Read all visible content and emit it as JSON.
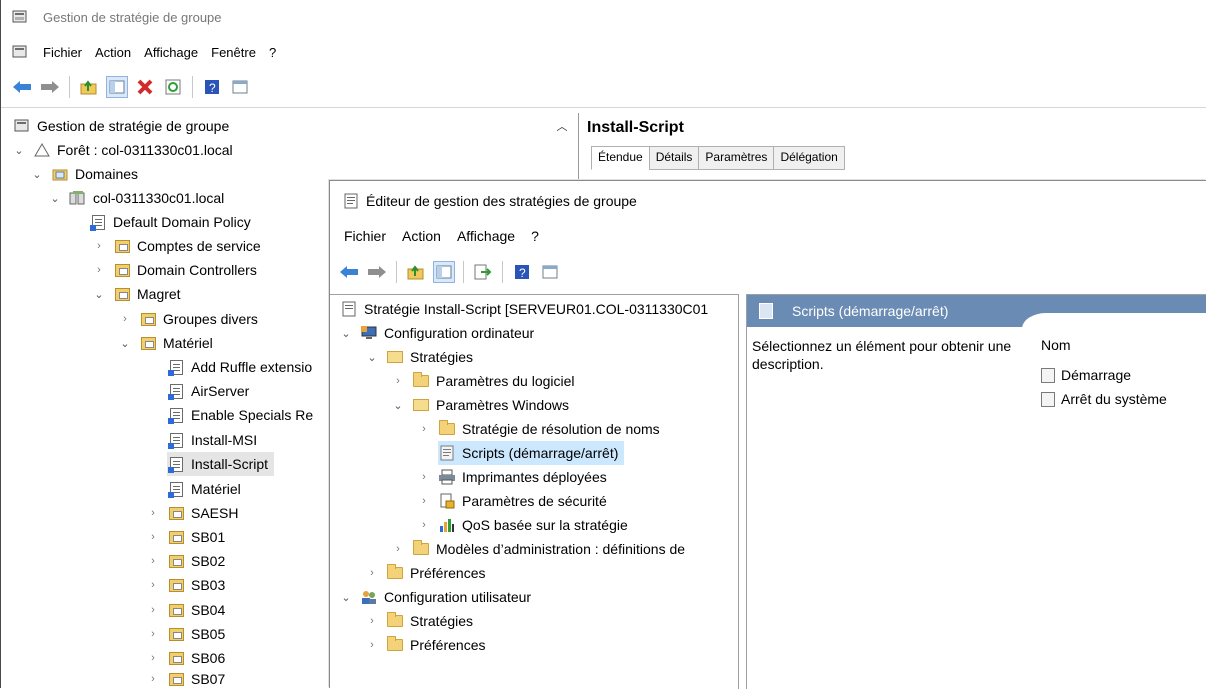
{
  "app": {
    "title": "Gestion de stratégie de groupe",
    "menu": [
      "Fichier",
      "Action",
      "Affichage",
      "Fenêtre",
      "?"
    ]
  },
  "tree": {
    "root": "Gestion de stratégie de groupe",
    "forest": "Forêt : col-0311330c01.local",
    "domains": "Domaines",
    "domain": "col-0311330c01.local",
    "items": {
      "ddp": "Default Domain Policy",
      "comptes": "Comptes de service",
      "dc": "Domain Controllers",
      "magret": "Magret",
      "groupes": "Groupes divers",
      "materiel": "Matériel",
      "addruffle": "Add Ruffle extensio",
      "airserver": "AirServer",
      "enablespecials": "Enable Specials Re",
      "installmsi": "Install-MSI",
      "installscript": "Install-Script",
      "materielgpo": "Matériel",
      "saesh": "SAESH",
      "sb01": "SB01",
      "sb02": "SB02",
      "sb03": "SB03",
      "sb04": "SB04",
      "sb05": "SB05",
      "sb06": "SB06",
      "sb07": "SB07"
    }
  },
  "gpo_panel": {
    "title": "Install-Script",
    "tabs": [
      "Étendue",
      "Détails",
      "Paramètres",
      "Délégation"
    ]
  },
  "editor": {
    "title": "Éditeur de gestion des stratégies de groupe",
    "menu": [
      "Fichier",
      "Action",
      "Affichage",
      "?"
    ],
    "tree": {
      "root": "Stratégie Install-Script [SERVEUR01.COL-0311330C01",
      "comp_config": "Configuration ordinateur",
      "strategies": "Stratégies",
      "param_logiciel": "Paramètres du logiciel",
      "param_windows": "Paramètres Windows",
      "resolution_noms": "Stratégie de résolution de noms",
      "scripts": "Scripts (démarrage/arrêt)",
      "imprimantes": "Imprimantes déployées",
      "securite": "Paramètres de sécurité",
      "qos": "QoS basée sur la stratégie",
      "modeles": "Modèles d’administration : définitions de",
      "preferences": "Préférences",
      "user_config": "Configuration utilisateur",
      "user_strategies": "Stratégies",
      "user_preferences": "Préférences"
    },
    "right": {
      "header": "Scripts (démarrage/arrêt)",
      "description": "Sélectionnez un élément pour obtenir une description.",
      "column": "Nom",
      "items": [
        "Démarrage",
        "Arrêt du système"
      ]
    }
  },
  "colors": {
    "header_band": "#6a8bb3",
    "selection": "#cce8ff",
    "folder": "#f4d27a"
  }
}
